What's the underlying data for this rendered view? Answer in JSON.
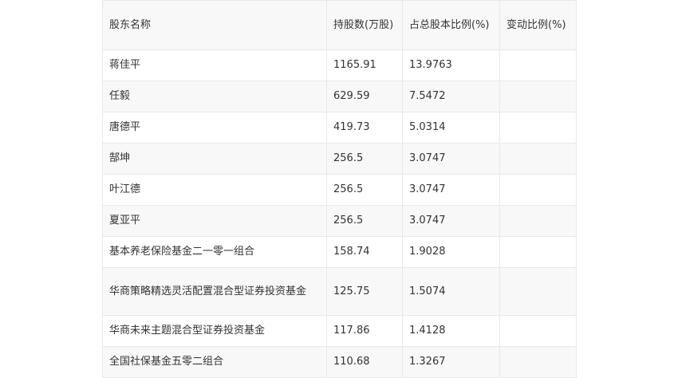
{
  "table": {
    "headers": {
      "name": "股东名称",
      "shares": "持股数(万股)",
      "ratio": "占总股本比例(%)",
      "change": "变动比例(%)"
    },
    "rows": [
      {
        "name": "蒋佳平",
        "shares": "1165.91",
        "ratio": "13.9763",
        "change": ""
      },
      {
        "name": "任毅",
        "shares": "629.59",
        "ratio": "7.5472",
        "change": ""
      },
      {
        "name": "唐德平",
        "shares": "419.73",
        "ratio": "5.0314",
        "change": ""
      },
      {
        "name": "郜坤",
        "shares": "256.5",
        "ratio": "3.0747",
        "change": ""
      },
      {
        "name": "叶江德",
        "shares": "256.5",
        "ratio": "3.0747",
        "change": ""
      },
      {
        "name": "夏亚平",
        "shares": "256.5",
        "ratio": "3.0747",
        "change": ""
      },
      {
        "name": "基本养老保险基金二一零一组合",
        "shares": "158.74",
        "ratio": "1.9028",
        "change": ""
      },
      {
        "name": "华商策略精选灵活配置混合型证券投资基金",
        "shares": "125.75",
        "ratio": "1.5074",
        "change": ""
      },
      {
        "name": "华商未来主题混合型证券投资基金",
        "shares": "117.86",
        "ratio": "1.4128",
        "change": ""
      },
      {
        "name": "全国社保基金五零二组合",
        "shares": "110.68",
        "ratio": "1.3267",
        "change": ""
      }
    ]
  }
}
